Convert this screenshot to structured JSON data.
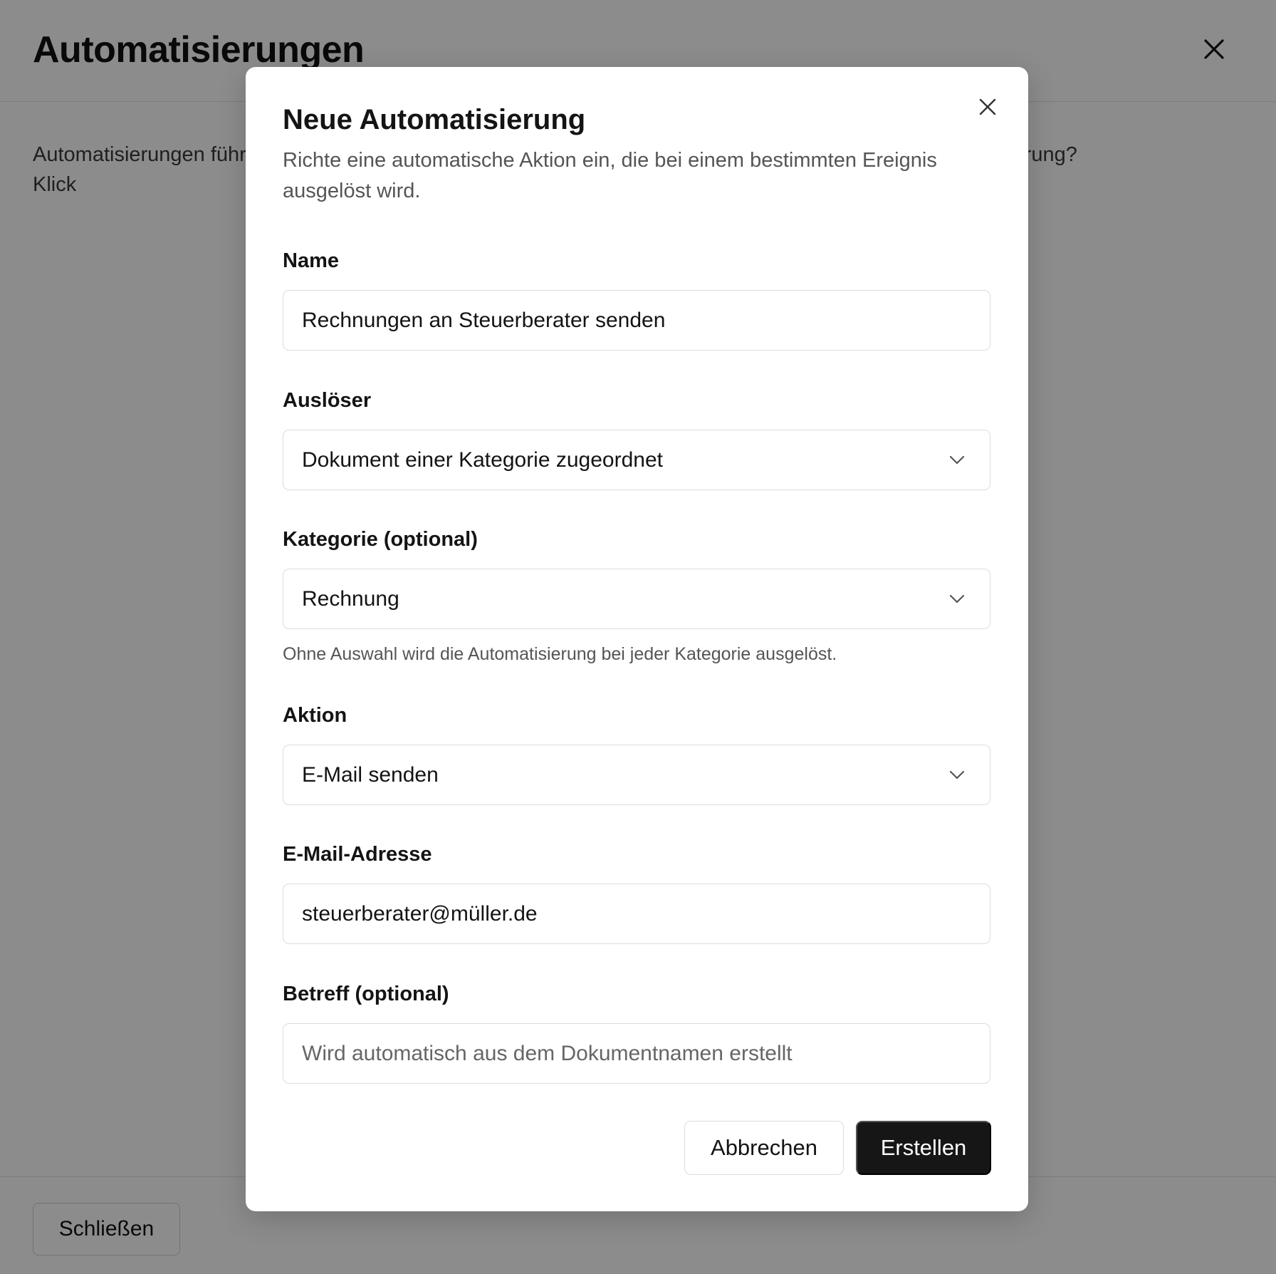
{
  "page": {
    "title": "Automatisierungen",
    "description": "Automatisierungen führen eine Aktion aus, sobald ein bestimmtes Ereignis eintritt. Brauchst eine Automatisierung? Klick",
    "close_button": "Schließen",
    "close_icon": "close-icon"
  },
  "modal": {
    "title": "Neue Automatisierung",
    "description": "Richte eine automatische Aktion ein, die bei einem bestimmten Ereignis ausgelöst wird.",
    "close_icon": "close-icon",
    "fields": {
      "name": {
        "label": "Name",
        "value": "Rechnungen an Steuerberater senden"
      },
      "trigger": {
        "label": "Auslöser",
        "value": "Dokument einer Kategorie zugeordnet",
        "icon": "chevron-down-icon"
      },
      "category": {
        "label": "Kategorie (optional)",
        "value": "Rechnung",
        "hint": "Ohne Auswahl wird die Automatisierung bei jeder Kategorie ausgelöst.",
        "icon": "chevron-down-icon"
      },
      "action": {
        "label": "Aktion",
        "value": "E-Mail senden",
        "icon": "chevron-down-icon"
      },
      "email": {
        "label": "E-Mail-Adresse",
        "value": "steuerberater@müller.de"
      },
      "subject": {
        "label": "Betreff (optional)",
        "value": "",
        "placeholder": "Wird automatisch aus dem Dokumentnamen erstellt"
      }
    },
    "buttons": {
      "cancel": "Abbrechen",
      "create": "Erstellen"
    }
  },
  "colors": {
    "overlay": "rgba(0,0,0,0.45)",
    "primary_button": "#161616",
    "border": "#dcdcdc"
  }
}
